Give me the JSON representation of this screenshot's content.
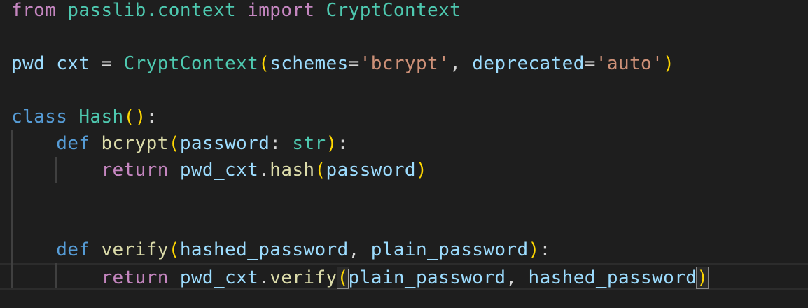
{
  "editor": {
    "language": "python",
    "colors": {
      "background": "#1e1e1e",
      "keyword_control": "#c586c0",
      "keyword": "#569cd6",
      "class": "#4ec9b0",
      "function": "#dcdcaa",
      "variable": "#9cdcfe",
      "string": "#ce9178",
      "text": "#d4d4d4",
      "bracket_level1": "#ffd700",
      "bracket_level2": "#da70d6"
    },
    "lines": [
      {
        "tokens": [
          {
            "t": "from",
            "c": "kw-ctrl"
          },
          {
            "t": " ",
            "c": "plain"
          },
          {
            "t": "passlib.context",
            "c": "cls"
          },
          {
            "t": " ",
            "c": "plain"
          },
          {
            "t": "import",
            "c": "kw-ctrl"
          },
          {
            "t": " ",
            "c": "plain"
          },
          {
            "t": "CryptContext",
            "c": "cls"
          }
        ]
      },
      {
        "tokens": []
      },
      {
        "tokens": [
          {
            "t": "pwd_cxt",
            "c": "var"
          },
          {
            "t": " = ",
            "c": "plain"
          },
          {
            "t": "CryptContext",
            "c": "cls"
          },
          {
            "t": "(",
            "c": "b1"
          },
          {
            "t": "schemes",
            "c": "var"
          },
          {
            "t": "=",
            "c": "plain"
          },
          {
            "t": "'bcrypt'",
            "c": "str"
          },
          {
            "t": ", ",
            "c": "plain"
          },
          {
            "t": "deprecated",
            "c": "var"
          },
          {
            "t": "=",
            "c": "plain"
          },
          {
            "t": "'auto'",
            "c": "str"
          },
          {
            "t": ")",
            "c": "b1"
          }
        ]
      },
      {
        "tokens": []
      },
      {
        "tokens": [
          {
            "t": "class",
            "c": "kw"
          },
          {
            "t": " ",
            "c": "plain"
          },
          {
            "t": "Hash",
            "c": "cls"
          },
          {
            "t": "()",
            "c": "b1"
          },
          {
            "t": ":",
            "c": "plain"
          }
        ]
      },
      {
        "tokens": [
          {
            "t": "    ",
            "c": "plain"
          },
          {
            "t": "def",
            "c": "kw"
          },
          {
            "t": " ",
            "c": "plain"
          },
          {
            "t": "bcrypt",
            "c": "fn"
          },
          {
            "t": "(",
            "c": "b1"
          },
          {
            "t": "password",
            "c": "var"
          },
          {
            "t": ": ",
            "c": "plain"
          },
          {
            "t": "str",
            "c": "cls"
          },
          {
            "t": ")",
            "c": "b1"
          },
          {
            "t": ":",
            "c": "plain"
          }
        ]
      },
      {
        "tokens": [
          {
            "t": "        ",
            "c": "plain"
          },
          {
            "t": "return",
            "c": "kw-ctrl"
          },
          {
            "t": " ",
            "c": "plain"
          },
          {
            "t": "pwd_cxt",
            "c": "var"
          },
          {
            "t": ".",
            "c": "plain"
          },
          {
            "t": "hash",
            "c": "fn"
          },
          {
            "t": "(",
            "c": "b1"
          },
          {
            "t": "password",
            "c": "var"
          },
          {
            "t": ")",
            "c": "b1"
          }
        ]
      },
      {
        "tokens": []
      },
      {
        "tokens": []
      },
      {
        "tokens": [
          {
            "t": "    ",
            "c": "plain"
          },
          {
            "t": "def",
            "c": "kw"
          },
          {
            "t": " ",
            "c": "plain"
          },
          {
            "t": "verify",
            "c": "fn"
          },
          {
            "t": "(",
            "c": "b1"
          },
          {
            "t": "hashed_password",
            "c": "var"
          },
          {
            "t": ", ",
            "c": "plain"
          },
          {
            "t": "plain_password",
            "c": "var"
          },
          {
            "t": ")",
            "c": "b1"
          },
          {
            "t": ":",
            "c": "plain"
          }
        ]
      },
      {
        "active": true,
        "tokens": [
          {
            "t": "        ",
            "c": "plain"
          },
          {
            "t": "return",
            "c": "kw-ctrl"
          },
          {
            "t": " ",
            "c": "plain"
          },
          {
            "t": "pwd_cxt",
            "c": "var"
          },
          {
            "t": ".",
            "c": "plain"
          },
          {
            "t": "verify",
            "c": "fn"
          },
          {
            "t": "(",
            "c": "b1",
            "match": true
          },
          {
            "t": "",
            "c": "cursor"
          },
          {
            "t": "plain_password",
            "c": "var"
          },
          {
            "t": ", ",
            "c": "plain"
          },
          {
            "t": "hashed_password",
            "c": "var"
          },
          {
            "t": ")",
            "c": "b1",
            "match": true
          }
        ]
      }
    ]
  }
}
